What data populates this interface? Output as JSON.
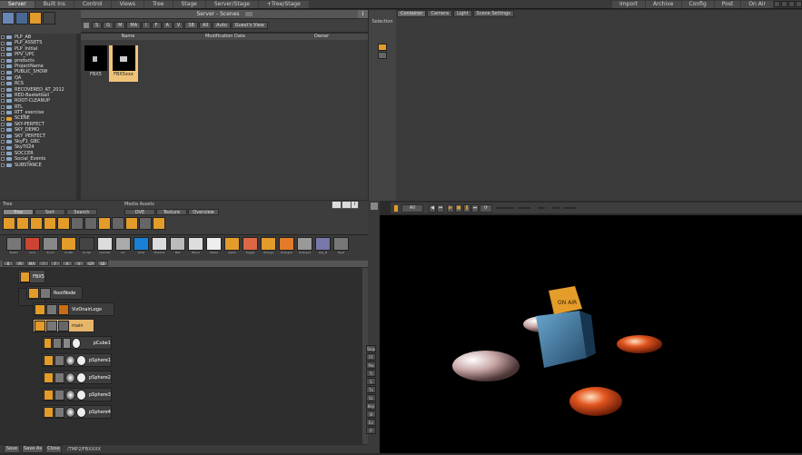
{
  "top_tabs_left": [
    "Server",
    "Built Ins",
    "Control",
    "Views",
    "Tree",
    "Stage",
    "Server/Stage",
    "+Tree/Stage"
  ],
  "top_tabs_right": [
    "Import",
    "Archive",
    "Config",
    "Post",
    "On Air"
  ],
  "server": {
    "title": "Server - Scenes",
    "filter_buttons": [
      "S",
      "G",
      "M",
      "MA",
      "I",
      "F",
      "A",
      "V",
      "SB",
      "All",
      "Auto",
      "Guest's View"
    ],
    "columns": [
      "Name",
      "Modification Date",
      "Owner"
    ],
    "folders": [
      {
        "name": "PLP_AB",
        "color": "blue"
      },
      {
        "name": "PLP_ASSETS",
        "color": "blue"
      },
      {
        "name": "PLP_Initial",
        "color": "blue"
      },
      {
        "name": "PPV_UPC",
        "color": "blue"
      },
      {
        "name": "products",
        "color": "blue"
      },
      {
        "name": "ProjectName",
        "color": "blue"
      },
      {
        "name": "PUBLIC_SHOW",
        "color": "blue"
      },
      {
        "name": "QA",
        "color": "blue"
      },
      {
        "name": "RCS",
        "color": "blue"
      },
      {
        "name": "RECOVERED_AT_2012",
        "color": "blue"
      },
      {
        "name": "RED-Basketball",
        "color": "blue"
      },
      {
        "name": "ROOT-CLEANUP",
        "color": "blue"
      },
      {
        "name": "RTL",
        "color": "blue"
      },
      {
        "name": "RTT_exercise",
        "color": "blue"
      },
      {
        "name": "SCENE",
        "color": "orange"
      },
      {
        "name": "SKY-PERFECT",
        "color": "blue"
      },
      {
        "name": "SKY_DEMO",
        "color": "blue"
      },
      {
        "name": "SKY_PERFECT",
        "color": "blue"
      },
      {
        "name": "SkyF1_GBC",
        "color": "blue"
      },
      {
        "name": "SkyT024",
        "color": "blue"
      },
      {
        "name": "SOCCER",
        "color": "blue"
      },
      {
        "name": "Social_Events",
        "color": "blue"
      },
      {
        "name": "SUBSTANCE",
        "color": "blue"
      }
    ],
    "scenes": [
      "FBX5",
      "FBX5xxx"
    ]
  },
  "right_top": {
    "tabs": [
      "Container",
      "Camera",
      "Light",
      "Scene Settings"
    ],
    "selection_label": "Selection"
  },
  "tree_panel": {
    "title": "Tree",
    "buttons": [
      "Tree",
      "Sort",
      "Search"
    ],
    "nav_buttons": [
      "B",
      "M",
      "MA",
      "I",
      "F",
      "A",
      "V",
      "GP",
      "SB"
    ]
  },
  "media": {
    "title": "Media Assets",
    "buttons": [
      "DVE",
      "Texture",
      "Overview"
    ]
  },
  "plugins": [
    "Builtin",
    "Avid",
    "Scroll",
    "ConBr",
    "Script",
    "Cylinder",
    "Arc",
    "Glow",
    "Shadow",
    "Mat",
    "Bevel",
    "Metal",
    "Alpha",
    "Toggle",
    "Orange",
    "Orange2",
    "Orange3",
    "Key_B",
    "Key2"
  ],
  "nodes": [
    {
      "label": "FBX5"
    },
    {
      "label": "RootNode"
    },
    {
      "label": "VizOnairLogo"
    },
    {
      "label": "main"
    },
    {
      "label": "pCube1"
    },
    {
      "label": "pSphere1"
    },
    {
      "label": "pSphere2"
    },
    {
      "label": "pSphere3"
    },
    {
      "label": "pSphere4"
    }
  ],
  "bottom": {
    "save": "Save",
    "save_as": "Save As",
    "close": "Close",
    "path": "/TMP2/FBXXXX"
  },
  "viewer": {
    "all_label": "All",
    "logo_text": "ON AIR"
  },
  "right_side_tabs": [
    "Stop",
    "FF",
    "Rw",
    "Tr",
    "S",
    "Tx",
    "Sc",
    "Key",
    "St",
    "Ev",
    "P"
  ]
}
